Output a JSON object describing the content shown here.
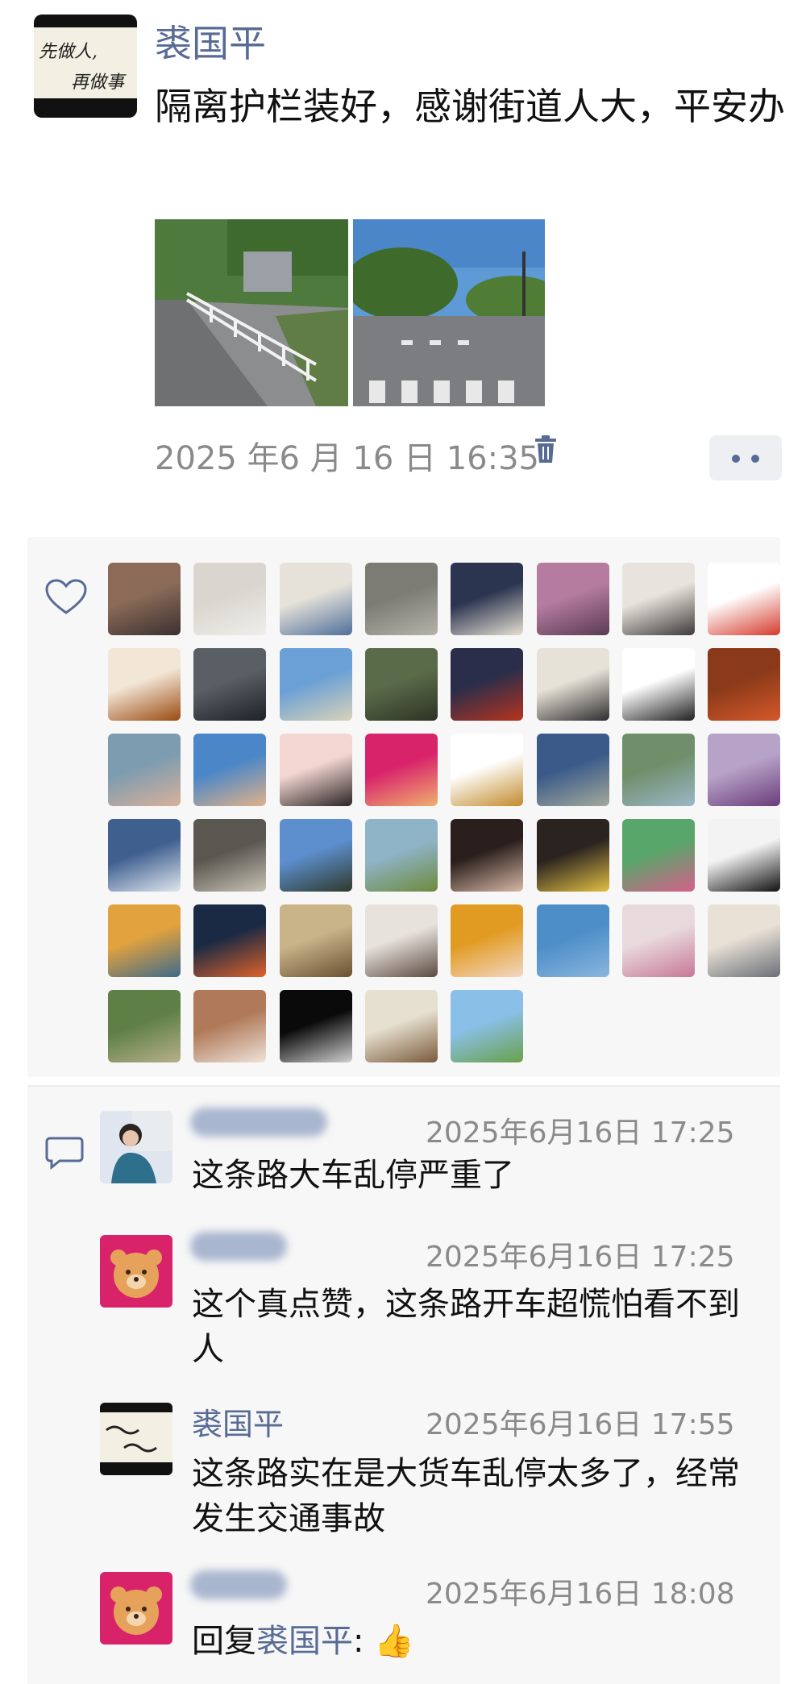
{
  "post": {
    "author": "裘国平",
    "avatar_text_line1": "先做人,",
    "avatar_text_line2": "再做事",
    "text": "隔离护栏装好，感谢街道人大，平安办",
    "timestamp": "2025 年6 月 16 日 16:35",
    "photos": [
      {
        "name": "street-with-guardrail-photo"
      },
      {
        "name": "road-intersection-photo"
      }
    ],
    "delete_icon": "trash-icon",
    "more_icon": "more-dots-icon"
  },
  "likes": {
    "icon": "heart-icon",
    "avatars": [
      {
        "c1": "#8b6b58",
        "c2": "#3b3030"
      },
      {
        "c1": "#d9d6cf",
        "c2": "#efeeea"
      },
      {
        "c1": "#e7e2d9",
        "c2": "#4f6f9a"
      },
      {
        "c1": "#7c7c74",
        "c2": "#b5b3aa"
      },
      {
        "c1": "#2b3550",
        "c2": "#e6e0d2"
      },
      {
        "c1": "#b57ca0",
        "c2": "#5a3b52"
      },
      {
        "c1": "#e8e4dd",
        "c2": "#3e3a3a"
      },
      {
        "c1": "#ffffff",
        "c2": "#d43a2c"
      },
      {
        "c1": "#f2e6d6",
        "c2": "#9a4a10"
      },
      {
        "c1": "#5a5f66",
        "c2": "#1e2126"
      },
      {
        "c1": "#6aa0d6",
        "c2": "#d9d2b9"
      },
      {
        "c1": "#5a6b4a",
        "c2": "#2d3324"
      },
      {
        "c1": "#2b2e4a",
        "c2": "#b7331e"
      },
      {
        "c1": "#e7e2d8",
        "c2": "#2e2e2e"
      },
      {
        "c1": "#ffffff",
        "c2": "#202020"
      },
      {
        "c1": "#8a3a1a",
        "c2": "#d6582a"
      },
      {
        "c1": "#7d9cb0",
        "c2": "#d8b19a"
      },
      {
        "c1": "#4a86c8",
        "c2": "#e0b28a"
      },
      {
        "c1": "#f3d6d2",
        "c2": "#2b2524"
      },
      {
        "c1": "#d8236b",
        "c2": "#f0b070"
      },
      {
        "c1": "#ffffff",
        "c2": "#c28a2a"
      },
      {
        "c1": "#3b5a8a",
        "c2": "#a3aa9a"
      },
      {
        "c1": "#6f8f6a",
        "c2": "#9bb7c8"
      },
      {
        "c1": "#b7a3c8",
        "c2": "#6a3c7a"
      },
      {
        "c1": "#3f5f8f",
        "c2": "#dfe6ee"
      },
      {
        "c1": "#5a5650",
        "c2": "#c9c3b5"
      },
      {
        "c1": "#5d8fcf",
        "c2": "#2f3a2c"
      },
      {
        "c1": "#8fb4c8",
        "c2": "#6d8a3c"
      },
      {
        "c1": "#2a1f1c",
        "c2": "#d8b8a6"
      },
      {
        "c1": "#2a2320",
        "c2": "#e2c044"
      },
      {
        "c1": "#58a66a",
        "c2": "#d65f8a"
      },
      {
        "c1": "#f3f3f3",
        "c2": "#111111"
      },
      {
        "c1": "#e2a23e",
        "c2": "#3f6a8a"
      },
      {
        "c1": "#1b2a44",
        "c2": "#e0622a"
      },
      {
        "c1": "#c9b48a",
        "c2": "#6a5030"
      },
      {
        "c1": "#e8e2dd",
        "c2": "#5a4a40"
      },
      {
        "c1": "#e29b22",
        "c2": "#f2d7c4"
      },
      {
        "c1": "#4d8ec8",
        "c2": "#8ab6de"
      },
      {
        "c1": "#e8d9dd",
        "c2": "#c77896"
      },
      {
        "c1": "#e9e1d6",
        "c2": "#6a6f78"
      },
      {
        "c1": "#5e7f46",
        "c2": "#b7b08a"
      },
      {
        "c1": "#b07a5a",
        "c2": "#efe3d9"
      },
      {
        "c1": "#0a0a0a",
        "c2": "#d0d0d0"
      },
      {
        "c1": "#e6e0d0",
        "c2": "#7a5a3a"
      },
      {
        "c1": "#8ac0e8",
        "c2": "#6aa04a"
      }
    ]
  },
  "comments": {
    "icon": "comment-icon",
    "items": [
      {
        "name": "",
        "time": "2025年6月16日 17:25",
        "text": "这条路大车乱停严重了",
        "av_c1": "#dfe6ef",
        "av_c2": "#2e6f8c"
      },
      {
        "name": "",
        "time": "2025年6月16日 17:25",
        "text": "这个真点赞，这条路开车超慌怕看不到人",
        "av_c1": "#d8236b",
        "av_c2": "#f0b070"
      },
      {
        "name": "裘国平",
        "time": "2025年6月16日 17:55",
        "text": "这条路实在是大货车乱停太多了，经常发生交通事故",
        "av_c1": "#111111",
        "av_c2": "#f4efe3"
      },
      {
        "name": "",
        "time": "2025年6月16日 18:08",
        "reply_prefix": "回复",
        "reply_to": "裘国平",
        "reply_suffix": ":",
        "emoji": "👍",
        "av_c1": "#d8236b",
        "av_c2": "#f0b070"
      }
    ]
  }
}
